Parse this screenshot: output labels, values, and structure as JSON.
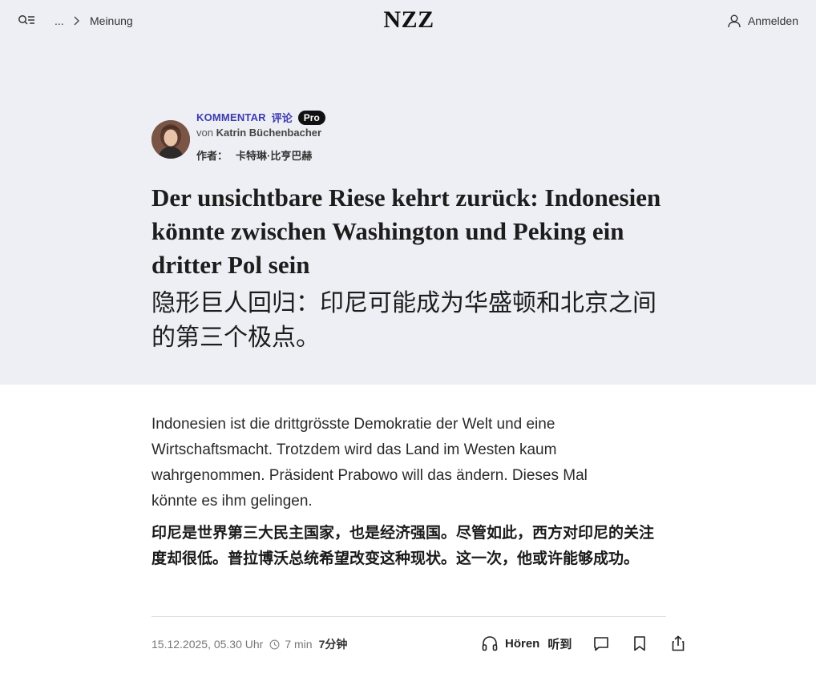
{
  "nav": {
    "breadcrumb_ellipsis": "...",
    "breadcrumb_section": "Meinung",
    "logo": "NZZ",
    "login_label": "Anmelden"
  },
  "article": {
    "kicker": "KOMMENTAR",
    "kicker_cn": "评论",
    "badge": "Pro",
    "byline_prefix": "von",
    "author": "Katrin Büchenbacher",
    "author_cn_label": "作者：",
    "author_cn_name": "卡特琳·比亨巴赫",
    "headline": "Der unsichtbare Riese kehrt zurück: Indonesien könnte zwischen Washington und Peking ein dritter Pol sein",
    "headline_cn": "隐形巨人回归：印尼可能成为华盛顿和北京之间的第三个极点。",
    "lead": "Indonesien ist die drittgrösste Demokratie der Welt und eine Wirtschaftsmacht. Trotzdem wird das Land im Westen kaum wahrgenommen. Präsident Prabowo will das ändern. Dieses Mal könnte es ihm gelingen.",
    "lead_cn": "印尼是世界第三大民主国家，也是经济强国。尽管如此，西方对印尼的关注度却很低。普拉博沃总统希望改变这种现状。这一次，他或许能够成功。"
  },
  "meta": {
    "date": "15.12.2025, 05.30 Uhr",
    "read_time": "7 min",
    "read_time_cn": "7分钟",
    "listen_label": "Hören",
    "listen_label_cn": "听到"
  },
  "icons": {
    "menu": "search-menu-icon",
    "chevron": "chevron-right-icon",
    "user": "user-icon",
    "clock": "clock-icon",
    "headphones": "headphones-icon",
    "comment": "comment-icon",
    "bookmark": "bookmark-icon",
    "share": "share-icon"
  },
  "colors": {
    "hero_bg": "#eeeef5",
    "kicker": "#3b3bb0",
    "badge_bg": "#111111"
  }
}
